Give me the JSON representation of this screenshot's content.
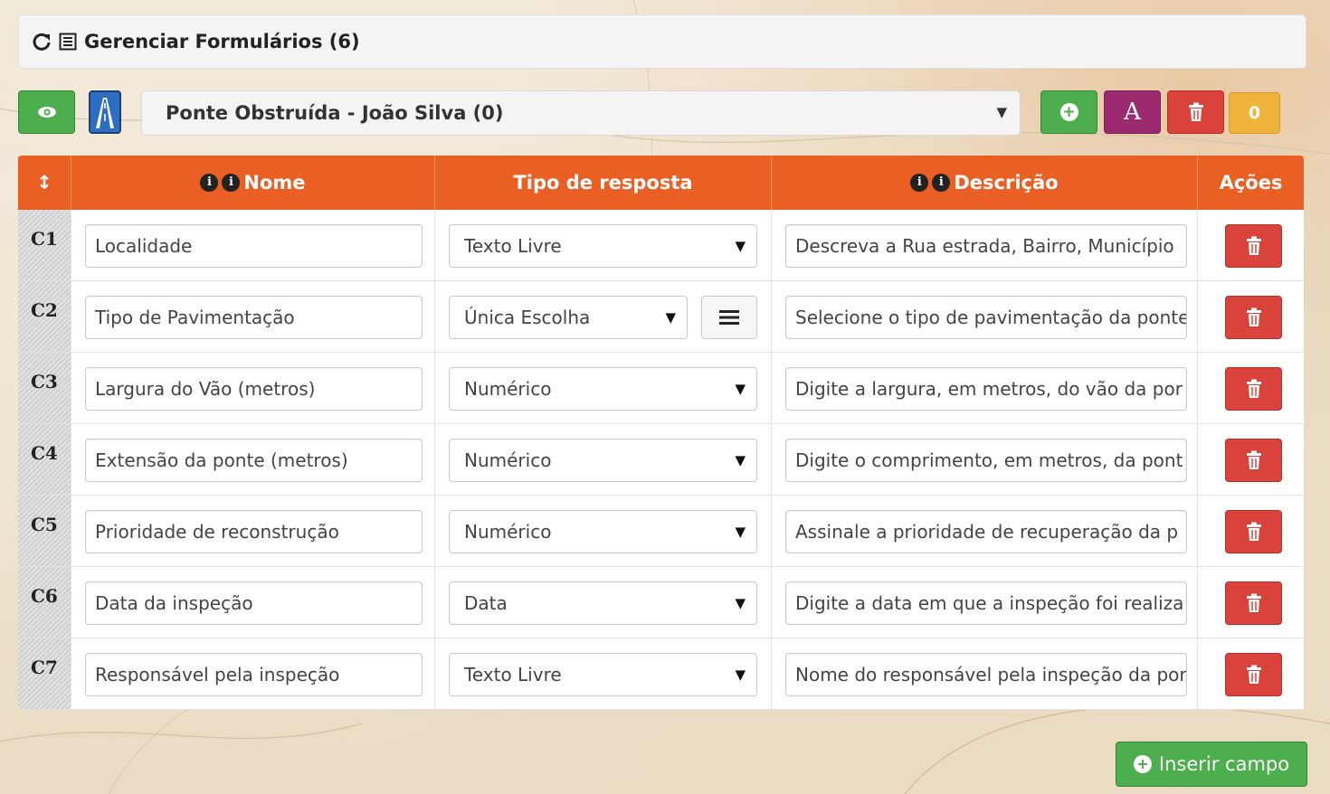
{
  "header": {
    "title": "Gerenciar Formulários (6)"
  },
  "toolbar": {
    "selected_form": "Ponte Obstruída - João Silva (0)",
    "font_button_label": "A",
    "count_badge": "0"
  },
  "table": {
    "columns": {
      "nome": "Nome",
      "tipo": "Tipo de resposta",
      "descricao": "Descrição",
      "acoes": "Ações"
    },
    "rows": [
      {
        "id": "C1",
        "nome": "Localidade",
        "tipo": "Texto Livre",
        "descricao": "Descreva a Rua estrada, Bairro, Município"
      },
      {
        "id": "C2",
        "nome": "Tipo de Pavimentação",
        "tipo": "Única Escolha",
        "descricao": "Selecione o tipo de pavimentação da ponte"
      },
      {
        "id": "C3",
        "nome": "Largura do Vão (metros)",
        "tipo": "Numérico",
        "descricao": "Digite a largura, em metros, do vão da por"
      },
      {
        "id": "C4",
        "nome": "Extensão da ponte (metros)",
        "tipo": "Numérico",
        "descricao": "Digite o comprimento, em metros, da pont"
      },
      {
        "id": "C5",
        "nome": "Prioridade de reconstrução",
        "tipo": "Numérico",
        "descricao": "Assinale a prioridade de recuperação da p"
      },
      {
        "id": "C6",
        "nome": "Data da inspeção",
        "tipo": "Data",
        "descricao": "Digite a data em que a inspeção foi realiza"
      },
      {
        "id": "C7",
        "nome": "Responsável pela inspeção",
        "tipo": "Texto Livre",
        "descricao": "Nome do responsável pela inspeção da por"
      }
    ]
  },
  "footer": {
    "insert_label": "Inserir campo"
  },
  "colors": {
    "header_orange": "#e95f24",
    "green": "#4cae4c",
    "red": "#d9433c",
    "purple": "#9b2a6f",
    "yellow": "#f0b33c"
  }
}
